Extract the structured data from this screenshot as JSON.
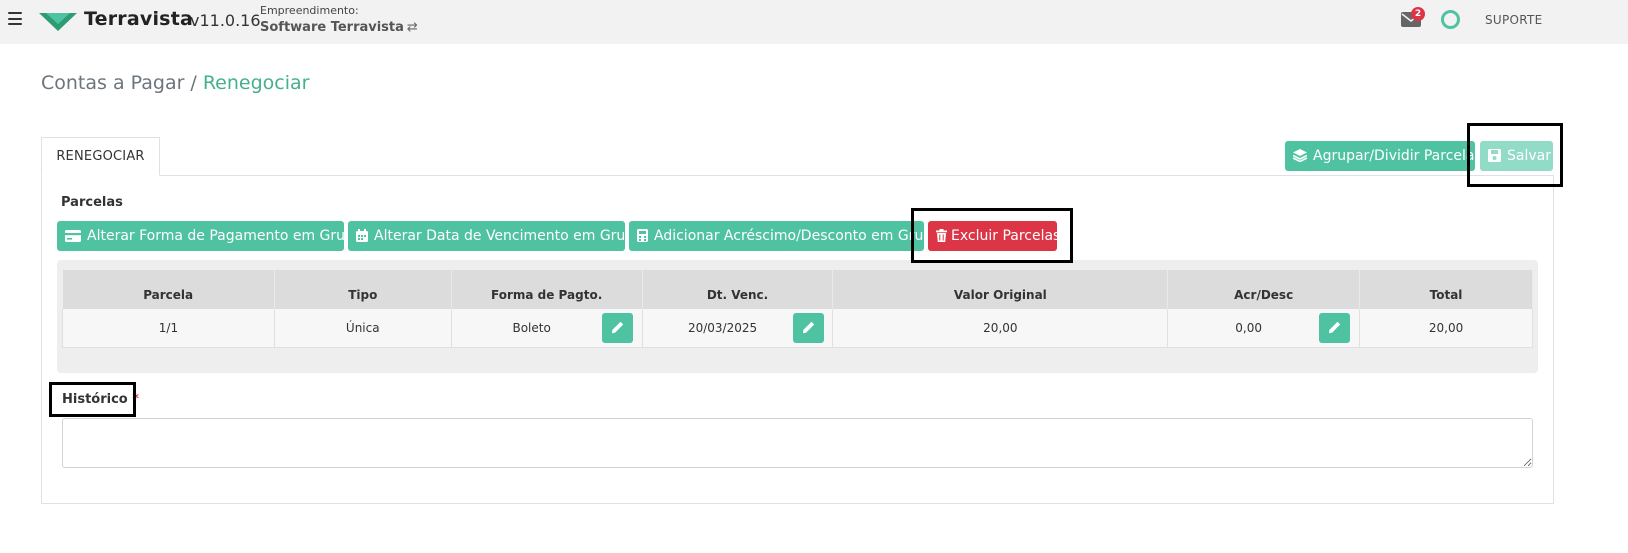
{
  "header": {
    "brand": "Terravista",
    "version": "v11.0.16",
    "empreendimento_label": "Empreendimento:",
    "empreendimento_name": "Software Terravista",
    "swap_symbol": "⇄",
    "notification_count": "2",
    "support_label": "SUPORTE",
    "colors": {
      "accent": "#4fc3a1",
      "badge": "#dc3545"
    }
  },
  "breadcrumb": {
    "parent": "Contas a Pagar",
    "separator": "/",
    "current": "Renegociar"
  },
  "tabs": [
    {
      "label": "RENEGOCIAR",
      "active": true
    }
  ],
  "actions": {
    "group_split": "Agrupar/Dividir Parcelas",
    "save": "Salvar"
  },
  "parcelas": {
    "title": "Parcelas",
    "buttons": {
      "alter_payment": "Alterar Forma de Pagamento em Grupo",
      "alter_due_date": "Alterar Data de Vencimento em Grupo",
      "add_surcharge": "Adicionar Acréscimo/Desconto em Grupo",
      "delete": "Excluir Parcelas"
    },
    "columns": [
      "Parcela",
      "Tipo",
      "Forma de Pagto.",
      "Dt. Venc.",
      "Valor Original",
      "Acr/Desc",
      "Total"
    ],
    "rows": [
      {
        "parcela": "1/1",
        "tipo": "Única",
        "forma": "Boleto",
        "vencimento": "20/03/2025",
        "valor_original": "20,00",
        "acr_desc": "0,00",
        "total": "20,00"
      }
    ]
  },
  "historico": {
    "label": "Histórico",
    "required_mark": "*",
    "value": ""
  }
}
